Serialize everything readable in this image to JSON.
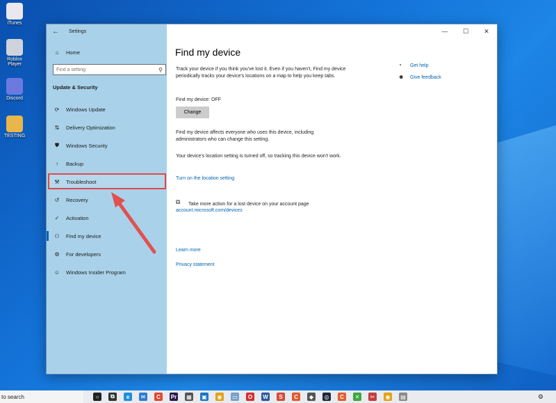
{
  "desktop": {
    "icons": [
      {
        "label": "iTunes",
        "icon": "itunes-icon",
        "color": "#e8e8ee"
      },
      {
        "label": "Roblox Player",
        "icon": "roblox-icon",
        "color": "#cfd4dc"
      },
      {
        "label": "Discord",
        "icon": "discord-icon",
        "color": "#6c7ae0"
      },
      {
        "label": "TESTING",
        "icon": "folder-icon",
        "color": "#e8b64a"
      }
    ]
  },
  "window": {
    "app_title": "Settings",
    "caption": {
      "minimize": "—",
      "maximize": "☐",
      "close": "✕"
    }
  },
  "sidebar": {
    "home_label": "Home",
    "search_placeholder": "Find a setting",
    "section_title": "Update & Security",
    "items": [
      {
        "label": "Windows Update",
        "icon": "sync-icon"
      },
      {
        "label": "Delivery Optimization",
        "icon": "delivery-icon"
      },
      {
        "label": "Windows Security",
        "icon": "shield-icon"
      },
      {
        "label": "Backup",
        "icon": "backup-icon"
      },
      {
        "label": "Troubleshoot",
        "icon": "wrench-icon"
      },
      {
        "label": "Recovery",
        "icon": "recovery-icon"
      },
      {
        "label": "Activation",
        "icon": "check-circle-icon"
      },
      {
        "label": "Find my device",
        "icon": "person-locate-icon"
      },
      {
        "label": "For developers",
        "icon": "developer-icon"
      },
      {
        "label": "Windows Insider Program",
        "icon": "insider-icon"
      }
    ],
    "active_item": "Find my device",
    "highlighted_item": "Troubleshoot"
  },
  "main": {
    "title": "Find my device",
    "description": "Track your device if you think you've lost it. Even if you haven't, Find my device periodically tracks your device's locations on a map to help you keep tabs.",
    "status": "Find my device: OFF",
    "change_button": "Change",
    "affects_text": "Find my device affects everyone who uses this device, including administrators who can change this setting.",
    "location_text": "Your device's location setting is turned off, so tracking this device won't work.",
    "location_link": "Turn on the location setting",
    "account_text": "Take more action for a lost device on your account page",
    "account_link": "account.microsoft.com/devices",
    "learn_more": "Learn more",
    "privacy": "Privacy statement",
    "get_help": "Get help",
    "give_feedback": "Give feedback"
  },
  "taskbar": {
    "search_text": "to search",
    "icons": [
      {
        "name": "cortana-icon",
        "color": "#222222",
        "glyph": "○"
      },
      {
        "name": "task-view-icon",
        "color": "#333333",
        "glyph": "⧉"
      },
      {
        "name": "edge-icon",
        "color": "#1f8fd8",
        "glyph": "e"
      },
      {
        "name": "mail-icon",
        "color": "#2f7cd0",
        "glyph": "✉"
      },
      {
        "name": "app-c-icon",
        "color": "#e0492f",
        "glyph": "C"
      },
      {
        "name": "premiere-icon",
        "color": "#2a1a4a",
        "glyph": "Pr"
      },
      {
        "name": "calculator-icon",
        "color": "#555555",
        "glyph": "▦"
      },
      {
        "name": "store-icon",
        "color": "#1a78c2",
        "glyph": "▣"
      },
      {
        "name": "chrome-icon",
        "color": "#e3a21a",
        "glyph": "◉"
      },
      {
        "name": "files-icon",
        "color": "#7aa2c8",
        "glyph": "▭"
      },
      {
        "name": "opera-icon",
        "color": "#d32f2f",
        "glyph": "O"
      },
      {
        "name": "word-icon",
        "color": "#2b579a",
        "glyph": "W"
      },
      {
        "name": "app-s-icon",
        "color": "#d84a3a",
        "glyph": "S"
      },
      {
        "name": "app-c2-icon",
        "color": "#e05a2f",
        "glyph": "C"
      },
      {
        "name": "roblox-task-icon",
        "color": "#555555",
        "glyph": "◆"
      },
      {
        "name": "steam-icon",
        "color": "#1b2838",
        "glyph": "◎"
      },
      {
        "name": "app-c3-icon",
        "color": "#e06030",
        "glyph": "C"
      },
      {
        "name": "camtasia-icon",
        "color": "#3ea63e",
        "glyph": "✕"
      },
      {
        "name": "snip-icon",
        "color": "#c04040",
        "glyph": "✂"
      },
      {
        "name": "chrome2-icon",
        "color": "#e3a21a",
        "glyph": "◉"
      },
      {
        "name": "app-t-icon",
        "color": "#8a8a8a",
        "glyph": "▤"
      }
    ],
    "tray_glyph": "⚙"
  }
}
